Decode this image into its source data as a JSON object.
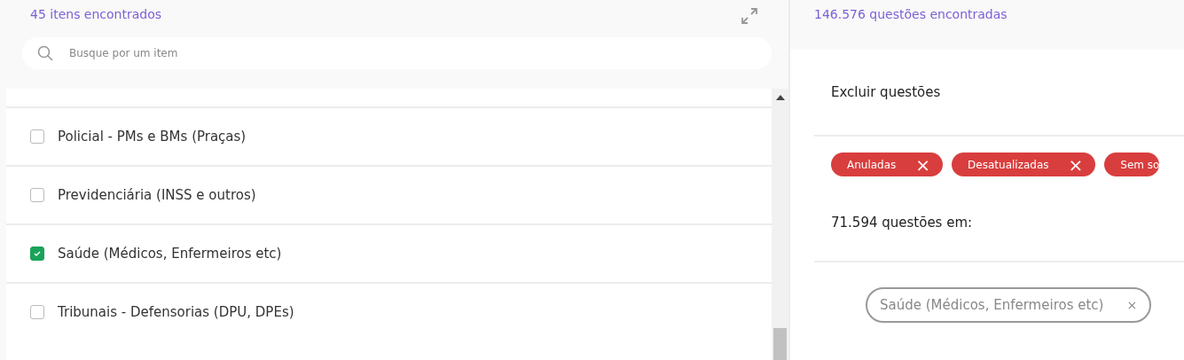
{
  "left": {
    "count": "45 itens encontrados",
    "search": {
      "placeholder": "Busque por um item"
    },
    "items": [
      {
        "label": "Policial - PMs e BMs (Praças)",
        "checked": false
      },
      {
        "label": "Previdenciária (INSS e outros)",
        "checked": false
      },
      {
        "label": "Saúde (Médicos, Enfermeiros etc)",
        "checked": true
      },
      {
        "label": "Tribunais - Defensorias (DPU, DPEs)",
        "checked": false
      }
    ]
  },
  "right": {
    "count": "146.576 questões encontradas",
    "exclude_title": "Excluir questões",
    "exclude_chips": [
      {
        "label": "Anuladas",
        "close": "×"
      },
      {
        "label": "Desatualizadas",
        "close": "×"
      },
      {
        "label": "Sem so"
      }
    ],
    "result_text": "71.594 questões em:",
    "filter_chips": [
      {
        "label": "Saúde (Médicos, Enfermeiros etc)",
        "close": "×"
      }
    ]
  }
}
